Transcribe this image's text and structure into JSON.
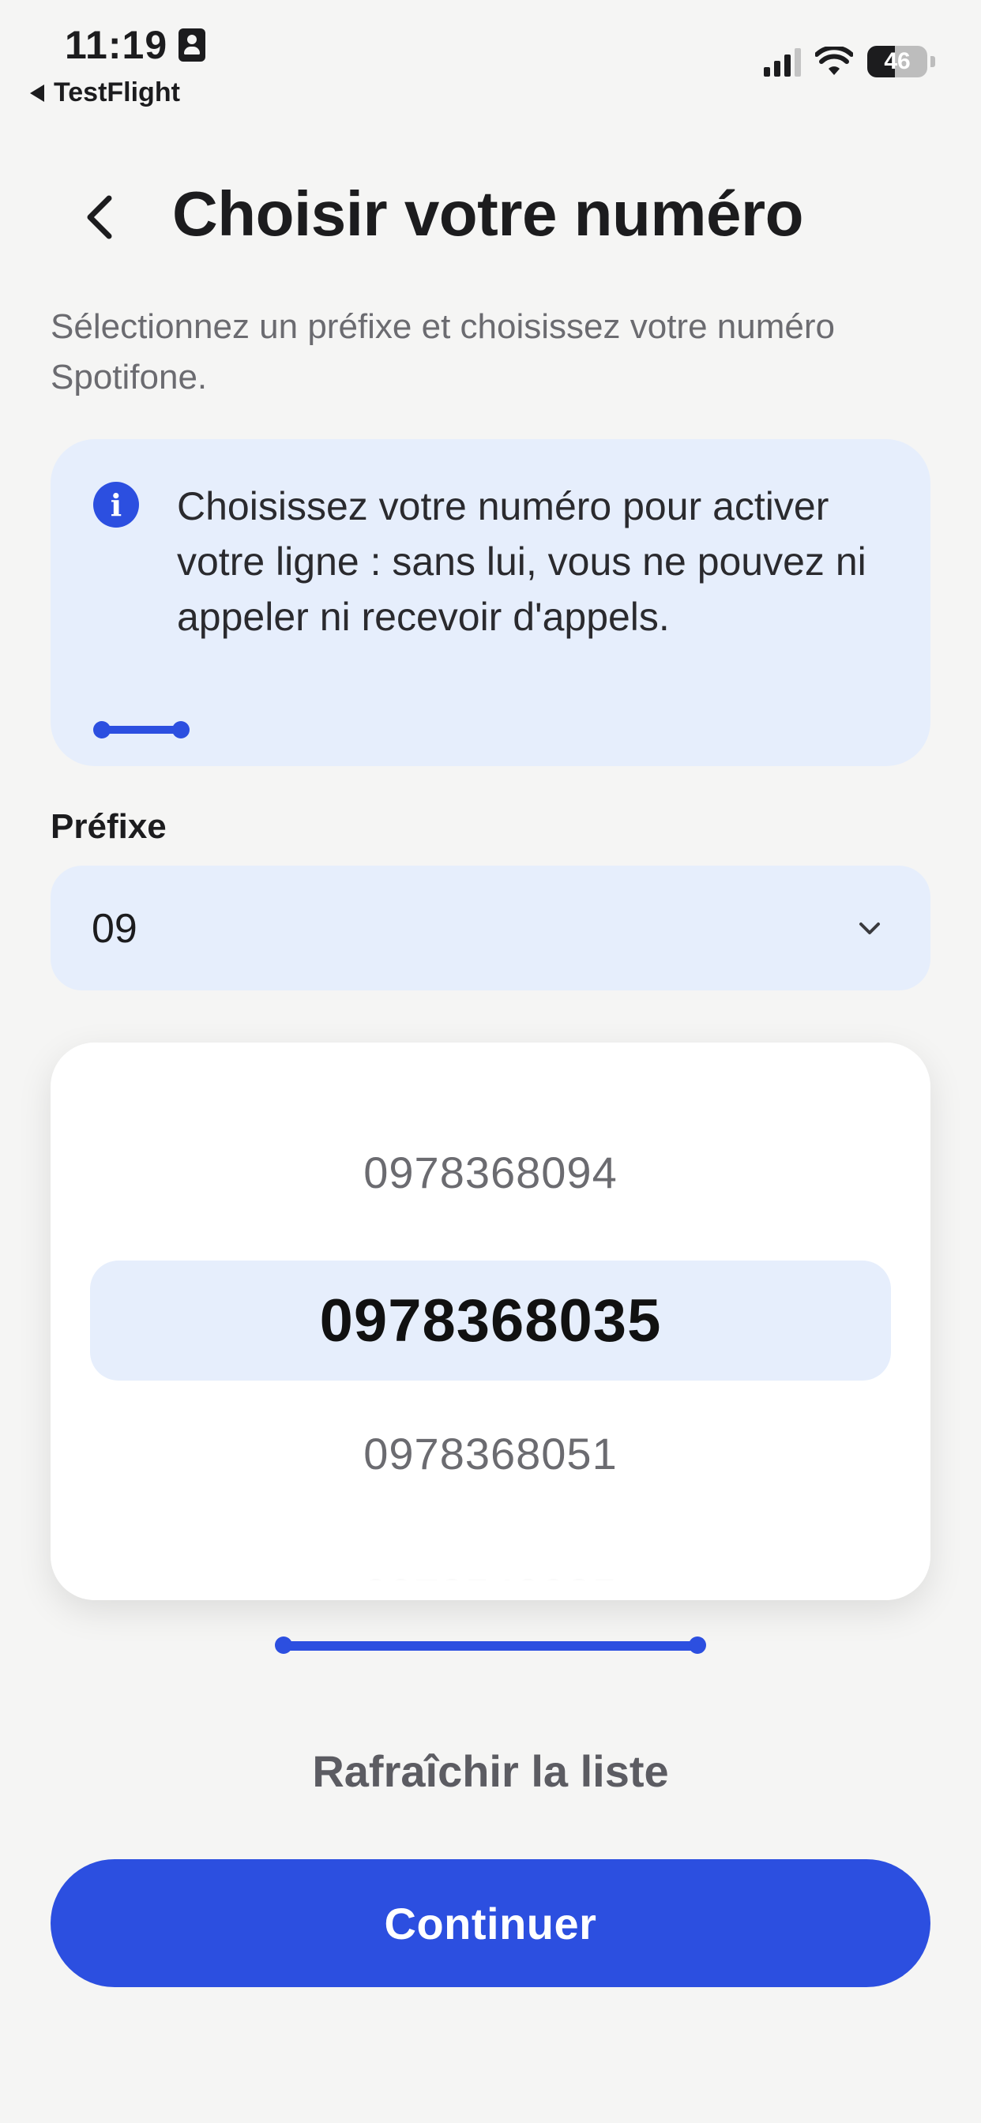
{
  "status_bar": {
    "time": "11:19",
    "back_app": "TestFlight",
    "battery": "46",
    "battery_level": 0.46
  },
  "header": {
    "title": "Choisir votre numéro",
    "subtitle": "Sélectionnez un préfixe et choisissez votre numéro Spotifone."
  },
  "info": {
    "text": "Choisissez votre numéro pour activer votre ligne : sans lui, vous ne pouvez ni appeler ni recevoir d'appels."
  },
  "prefix": {
    "label": "Préfixe",
    "value": "09"
  },
  "picker": {
    "items": [
      "0978368094",
      "0978368035",
      "0978368051"
    ],
    "selected_index": 1
  },
  "actions": {
    "refresh": "Rafraîchir la liste",
    "continue": "Continuer"
  },
  "colors": {
    "accent": "#2c4fe0",
    "card_bg": "#e6eefc",
    "page_bg": "#f5f5f4"
  },
  "icons": [
    "id-card-icon",
    "back-triangle-icon",
    "signal-icon",
    "wifi-icon",
    "battery-icon",
    "back-chevron-icon",
    "info-icon",
    "chevron-down-icon"
  ]
}
